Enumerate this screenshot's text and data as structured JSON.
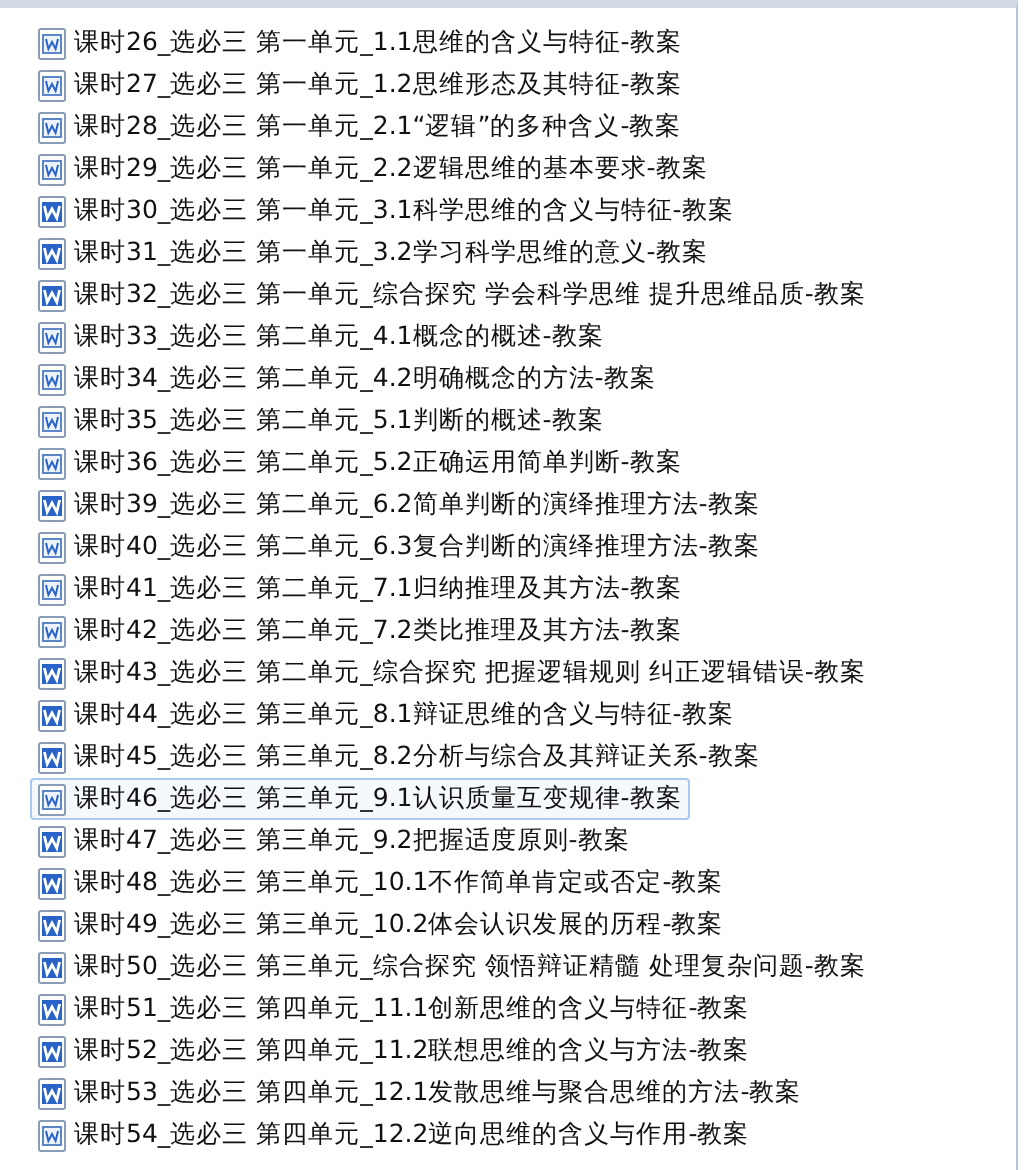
{
  "files": [
    {
      "name": "课时26_选必三 第一单元_1.1思维的含义与特征-教案",
      "kind": "doc",
      "selected": false
    },
    {
      "name": "课时27_选必三 第一单元_1.2思维形态及其特征-教案",
      "kind": "doc",
      "selected": false
    },
    {
      "name": "课时28_选必三 第一单元_2.1“逻辑”的多种含义-教案",
      "kind": "doc",
      "selected": false
    },
    {
      "name": "课时29_选必三 第一单元_2.2逻辑思维的基本要求-教案",
      "kind": "doc",
      "selected": false
    },
    {
      "name": "课时30_选必三 第一单元_3.1科学思维的含义与特征-教案",
      "kind": "docx",
      "selected": false
    },
    {
      "name": "课时31_选必三 第一单元_3.2学习科学思维的意义-教案",
      "kind": "docx",
      "selected": false
    },
    {
      "name": "课时32_选必三 第一单元_综合探究 学会科学思维 提升思维品质-教案",
      "kind": "docx",
      "selected": false
    },
    {
      "name": "课时33_选必三 第二单元_4.1概念的概述-教案",
      "kind": "doc",
      "selected": false
    },
    {
      "name": "课时34_选必三 第二单元_4.2明确概念的方法-教案",
      "kind": "doc",
      "selected": false
    },
    {
      "name": "课时35_选必三 第二单元_5.1判断的概述-教案",
      "kind": "doc",
      "selected": false
    },
    {
      "name": "课时36_选必三 第二单元_5.2正确运用简单判断-教案",
      "kind": "doc",
      "selected": false
    },
    {
      "name": "课时39_选必三 第二单元_6.2简单判断的演绎推理方法-教案",
      "kind": "docx",
      "selected": false
    },
    {
      "name": "课时40_选必三 第二单元_6.3复合判断的演绎推理方法-教案",
      "kind": "doc",
      "selected": false
    },
    {
      "name": "课时41_选必三 第二单元_7.1归纳推理及其方法-教案",
      "kind": "doc",
      "selected": false
    },
    {
      "name": "课时42_选必三 第二单元_7.2类比推理及其方法-教案",
      "kind": "doc",
      "selected": false
    },
    {
      "name": "课时43_选必三 第二单元_综合探究 把握逻辑规则 纠正逻辑错误-教案",
      "kind": "docx",
      "selected": false
    },
    {
      "name": "课时44_选必三 第三单元_8.1辩证思维的含义与特征-教案",
      "kind": "docx",
      "selected": false
    },
    {
      "name": "课时45_选必三 第三单元_8.2分析与综合及其辩证关系-教案",
      "kind": "docx",
      "selected": false
    },
    {
      "name": "课时46_选必三 第三单元_9.1认识质量互变规律-教案",
      "kind": "doc",
      "selected": true
    },
    {
      "name": "课时47_选必三 第三单元_9.2把握适度原则-教案",
      "kind": "docx",
      "selected": false
    },
    {
      "name": "课时48_选必三 第三单元_10.1不作简单肯定或否定-教案",
      "kind": "docx",
      "selected": false
    },
    {
      "name": "课时49_选必三 第三单元_10.2体会认识发展的历程-教案",
      "kind": "docx",
      "selected": false
    },
    {
      "name": "课时50_选必三 第三单元_综合探究 领悟辩证精髓 处理复杂问题-教案",
      "kind": "docx",
      "selected": false
    },
    {
      "name": "课时51_选必三 第四单元_11.1创新思维的含义与特征-教案",
      "kind": "docx",
      "selected": false
    },
    {
      "name": "课时52_选必三 第四单元_11.2联想思维的含义与方法-教案",
      "kind": "docx",
      "selected": false
    },
    {
      "name": "课时53_选必三 第四单元_12.1发散思维与聚合思维的方法-教案",
      "kind": "docx",
      "selected": false
    },
    {
      "name": "课时54_选必三 第四单元_12.2逆向思维的含义与作用-教案",
      "kind": "doc",
      "selected": false
    }
  ]
}
